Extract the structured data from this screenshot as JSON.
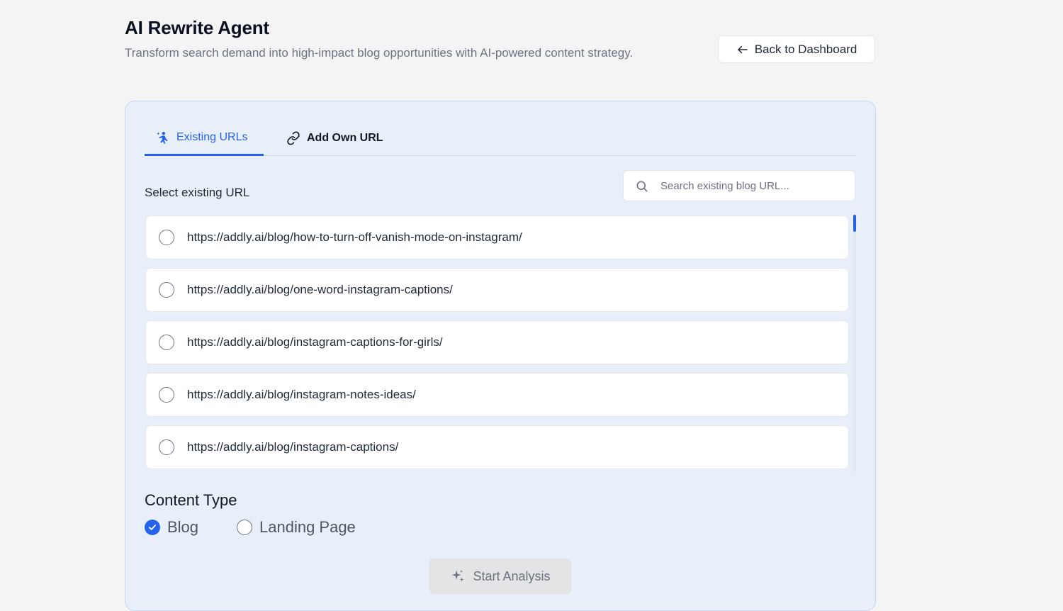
{
  "header": {
    "title": "AI Rewrite Agent",
    "subtitle": "Transform search demand into high-impact blog opportunities with AI-powered content strategy.",
    "back_label": "Back to Dashboard"
  },
  "tabs": [
    {
      "label": "Existing URLs",
      "icon": "sparkle-person-icon",
      "active": true
    },
    {
      "label": "Add Own URL",
      "icon": "link-icon",
      "active": false
    }
  ],
  "url_section": {
    "label": "Select existing URL",
    "search_placeholder": "Search existing blog URL...",
    "urls": [
      "https://addly.ai/blog/how-to-turn-off-vanish-mode-on-instagram/",
      "https://addly.ai/blog/one-word-instagram-captions/",
      "https://addly.ai/blog/instagram-captions-for-girls/",
      "https://addly.ai/blog/instagram-notes-ideas/",
      "https://addly.ai/blog/instagram-captions/"
    ]
  },
  "content_type": {
    "label": "Content Type",
    "options": [
      {
        "label": "Blog",
        "selected": true
      },
      {
        "label": "Landing Page",
        "selected": false
      }
    ]
  },
  "actions": {
    "start_label": "Start Analysis"
  },
  "colors": {
    "accent": "#2563eb",
    "card_bg": "#e9eff8",
    "page_bg": "#f4f4f5"
  }
}
